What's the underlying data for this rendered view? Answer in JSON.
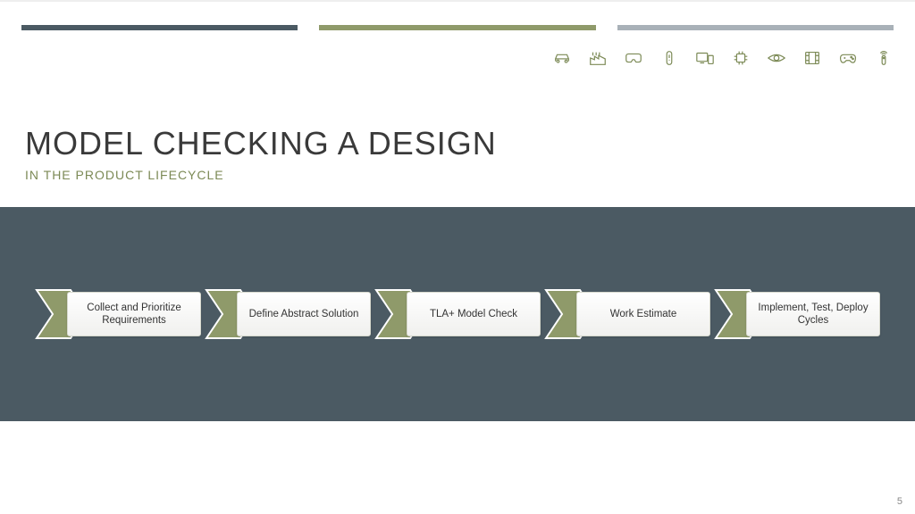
{
  "colors": {
    "stripe1": "#4b5a63",
    "stripe2": "#8f9a6a",
    "stripe3": "#a9b1b8",
    "accent_olive": "#7c8a56",
    "panel_bg": "#4b5a63"
  },
  "icons": [
    "car-icon",
    "factory-icon",
    "vr-headset-icon",
    "wearable-band-icon",
    "devices-icon",
    "chip-icon",
    "eye-icon",
    "film-icon",
    "gamepad-icon",
    "remote-wifi-icon"
  ],
  "title": "MODEL CHECKING A DESIGN",
  "subtitle": "IN THE PRODUCT LIFECYCLE",
  "steps": [
    {
      "label": "Collect and Prioritize Requirements"
    },
    {
      "label": "Define Abstract Solution"
    },
    {
      "label": "TLA+ Model Check"
    },
    {
      "label": "Work Estimate"
    },
    {
      "label": "Implement, Test, Deploy Cycles"
    }
  ],
  "page_number": "5"
}
